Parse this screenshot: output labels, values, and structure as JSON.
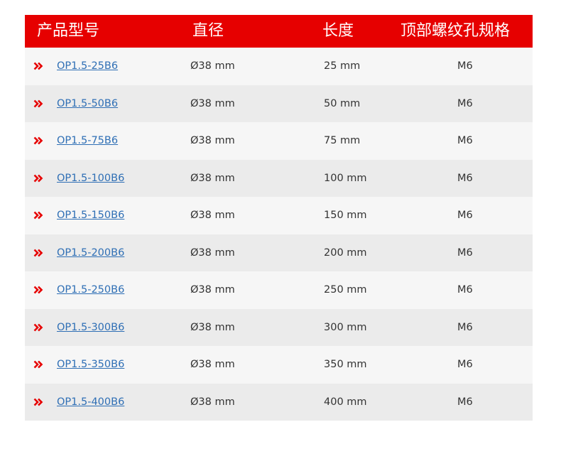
{
  "colors": {
    "header_bg": "#e60000",
    "header_text": "#ffffff",
    "link": "#2f6fb5",
    "arrow": "#e60000",
    "row_light": "#f6f6f6",
    "row_dark": "#ebebeb",
    "text": "#333333"
  },
  "table": {
    "headers": {
      "model": "产品型号",
      "diameter": "直径",
      "length": "长度",
      "thread": "顶部螺纹孔规格"
    },
    "row_icon": "double-chevron-right-icon",
    "rows": [
      {
        "model": "OP1.5-25B6",
        "diameter": "Ø38 mm",
        "length": "25 mm",
        "thread": "M6"
      },
      {
        "model": "OP1.5-50B6",
        "diameter": "Ø38 mm",
        "length": "50 mm",
        "thread": "M6"
      },
      {
        "model": "OP1.5-75B6",
        "diameter": "Ø38 mm",
        "length": "75 mm",
        "thread": "M6"
      },
      {
        "model": "OP1.5-100B6",
        "diameter": "Ø38 mm",
        "length": "100 mm",
        "thread": "M6"
      },
      {
        "model": "OP1.5-150B6",
        "diameter": "Ø38 mm",
        "length": "150 mm",
        "thread": "M6"
      },
      {
        "model": "OP1.5-200B6",
        "diameter": "Ø38 mm",
        "length": "200 mm",
        "thread": "M6"
      },
      {
        "model": "OP1.5-250B6",
        "diameter": "Ø38 mm",
        "length": "250 mm",
        "thread": "M6"
      },
      {
        "model": "OP1.5-300B6",
        "diameter": "Ø38 mm",
        "length": "300 mm",
        "thread": "M6"
      },
      {
        "model": "OP1.5-350B6",
        "diameter": "Ø38 mm",
        "length": "350 mm",
        "thread": "M6"
      },
      {
        "model": "OP1.5-400B6",
        "diameter": "Ø38 mm",
        "length": "400 mm",
        "thread": "M6"
      }
    ]
  }
}
